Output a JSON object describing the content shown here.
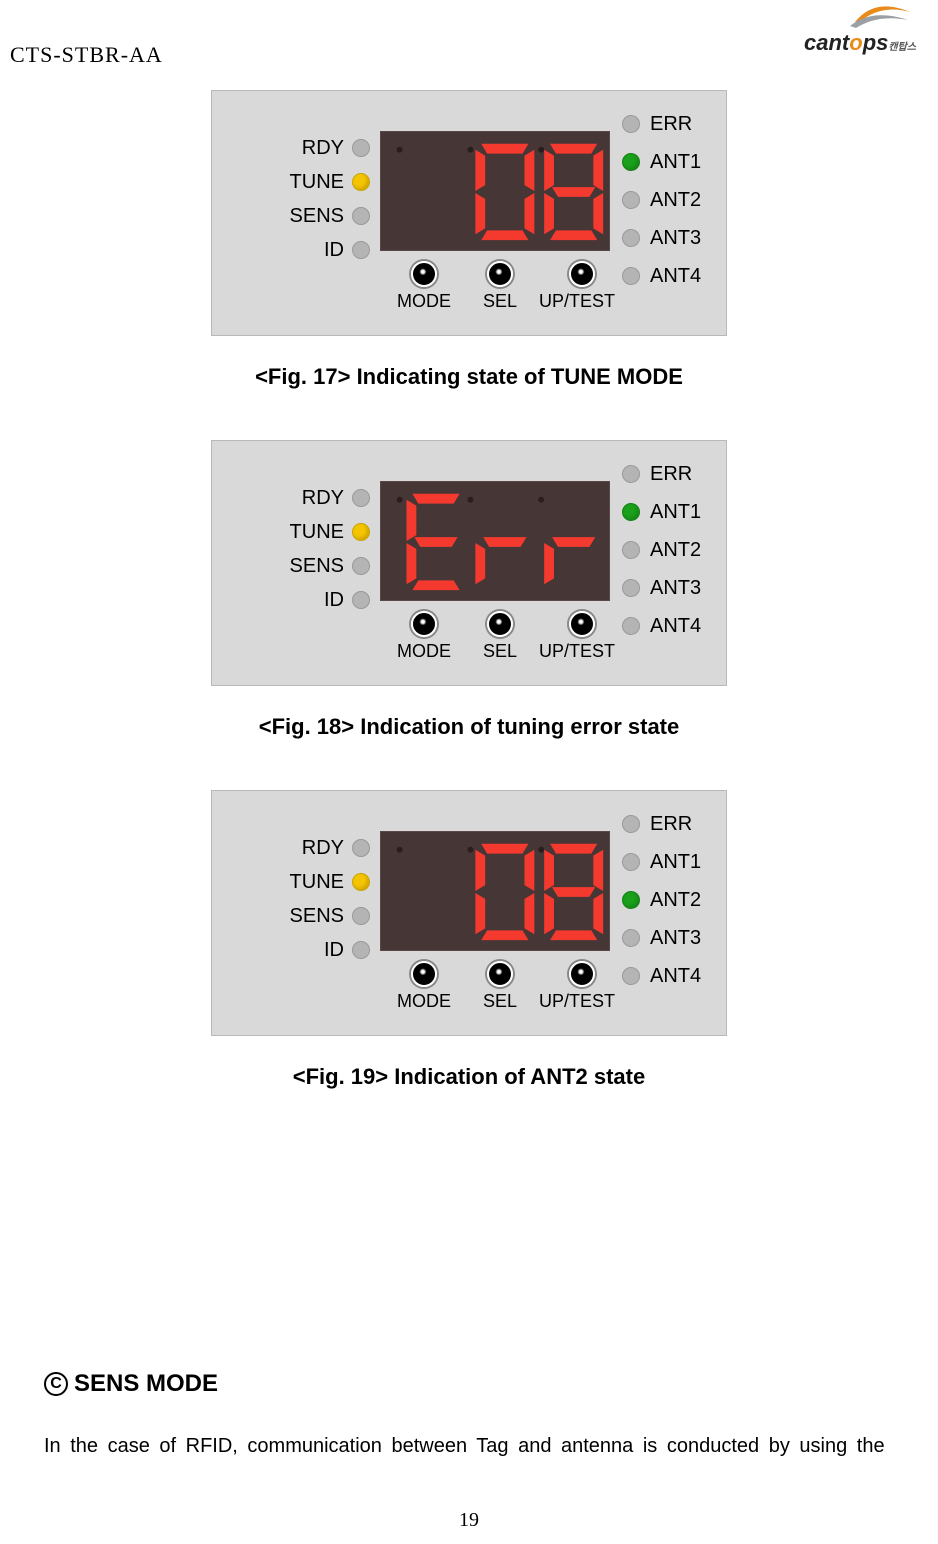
{
  "doc_code": "CTS-STBR-AA",
  "logo": {
    "brand": "cantops",
    "sub": "캔탑스"
  },
  "left_led_labels": [
    "RDY",
    "TUNE",
    "SENS",
    "ID"
  ],
  "right_led_labels": [
    "ERR",
    "ANT1",
    "ANT2",
    "ANT3",
    "ANT4"
  ],
  "button_labels": [
    "MODE",
    "SEL",
    "UP/TEST"
  ],
  "panels": [
    {
      "display_text": "08",
      "left_states": [
        "off",
        "yellow",
        "off",
        "off"
      ],
      "right_states": [
        "off",
        "green",
        "off",
        "off",
        "off"
      ],
      "caption": "<Fig. 17> Indicating state of TUNE MODE"
    },
    {
      "display_text": "Err",
      "left_states": [
        "off",
        "yellow",
        "off",
        "off"
      ],
      "right_states": [
        "off",
        "green",
        "off",
        "off",
        "off"
      ],
      "caption": "<Fig. 18> Indication of tuning error state"
    },
    {
      "display_text": "08",
      "left_states": [
        "off",
        "yellow",
        "off",
        "off"
      ],
      "right_states": [
        "off",
        "off",
        "green",
        "off",
        "off"
      ],
      "caption": "<Fig. 19> Indication of ANT2 state"
    }
  ],
  "section_c": {
    "marker": "C",
    "title": "SENS MODE"
  },
  "body": "In the case of RFID, communication between Tag and antenna is conducted by using the",
  "page_number": "19"
}
